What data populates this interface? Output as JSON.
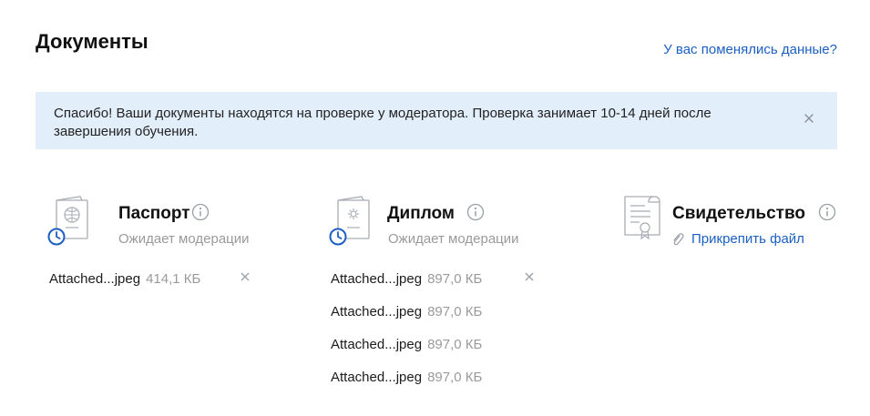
{
  "header": {
    "title": "Документы",
    "changed_link": "У вас поменялись данные?"
  },
  "notice": {
    "text": "Спасибо! Ваши документы находятся на проверке у модератора. Проверка занимает 10-14 дней после завершения обучения."
  },
  "documents": {
    "passport": {
      "title": "Паспорт",
      "status": "Ожидает модерации",
      "files": [
        {
          "name": "Attached...jpeg",
          "size": "414,1 КБ"
        }
      ]
    },
    "diploma": {
      "title": "Диплом",
      "status": "Ожидает модерации",
      "files": [
        {
          "name": "Attached...jpeg",
          "size": "897,0 КБ"
        },
        {
          "name": "Attached...jpeg",
          "size": "897,0 КБ"
        },
        {
          "name": "Attached...jpeg",
          "size": "897,0 КБ"
        },
        {
          "name": "Attached...jpeg",
          "size": "897,0 КБ"
        }
      ]
    },
    "certificate": {
      "title": "Свидетельство",
      "attach_label": "Прикрепить файл"
    }
  },
  "colors": {
    "link": "#1c5fc3",
    "notice_bg": "#e3eefb",
    "muted_text": "#9a9a9a",
    "clock_badge": "#1c5fc3"
  },
  "icons": {
    "passport": "passport-icon",
    "diploma": "diploma-icon",
    "certificate": "certificate-icon",
    "info": "info-icon",
    "close": "close-icon",
    "clip": "paperclip-icon",
    "pending": "clock-icon"
  }
}
